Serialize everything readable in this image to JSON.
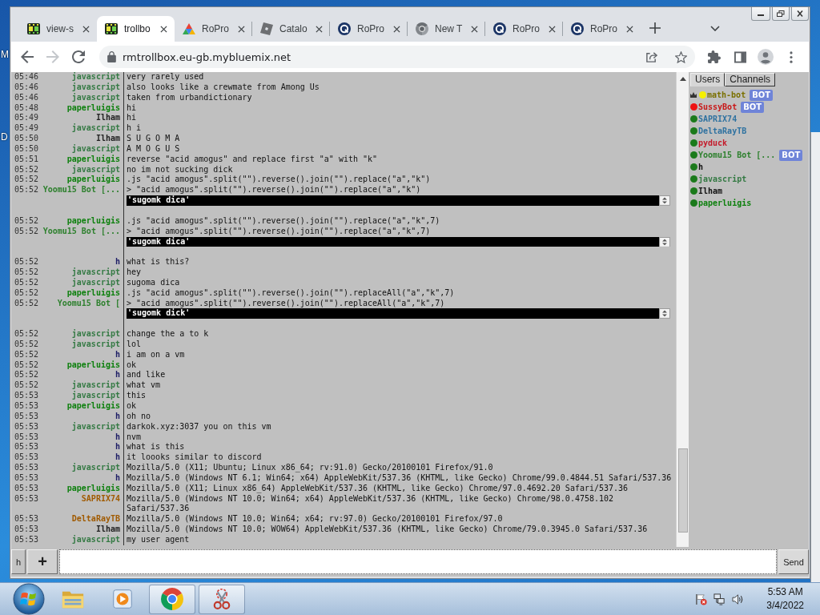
{
  "desktop": {
    "labels": [
      "M",
      "D"
    ]
  },
  "browser": {
    "tabs": [
      {
        "kind": "film",
        "title": "view-s",
        "selected": false
      },
      {
        "kind": "film",
        "title": "trollbo",
        "selected": true
      },
      {
        "kind": "triangle",
        "title": "RoPro",
        "selected": false
      },
      {
        "kind": "tile",
        "title": "Catalo",
        "selected": false
      },
      {
        "kind": "ring",
        "title": "RoPro",
        "selected": false
      },
      {
        "kind": "wheel",
        "title": "New T",
        "selected": false
      },
      {
        "kind": "ring",
        "title": "RoPro",
        "selected": false
      },
      {
        "kind": "ring",
        "title": "RoPro",
        "selected": false
      }
    ],
    "forward_disabled": true,
    "url": "rmtrollbox.eu-gb.mybluemix.net"
  },
  "chat": {
    "messages": [
      {
        "kind": "message",
        "time": "05:46",
        "name": "javascript",
        "color": "#357a44",
        "text": "very rarely used"
      },
      {
        "kind": "message",
        "time": "05:46",
        "name": "javascript",
        "color": "#357a44",
        "text": "also looks like a crewmate from Among Us"
      },
      {
        "kind": "message",
        "time": "05:46",
        "name": "javascript",
        "color": "#357a44",
        "text": "taken from urbandictionary"
      },
      {
        "kind": "message",
        "time": "05:48",
        "name": "paperluigis",
        "color": "#0e800e",
        "text": "hi"
      },
      {
        "kind": "message",
        "time": "05:49",
        "name": "Ilham",
        "color": "#222222",
        "text": "hi"
      },
      {
        "kind": "message",
        "time": "05:49",
        "name": "javascript",
        "color": "#357a44",
        "text": "h i"
      },
      {
        "kind": "message",
        "time": "05:50",
        "name": "Ilham",
        "color": "#222222",
        "text": "S U G O M A"
      },
      {
        "kind": "message",
        "time": "05:50",
        "name": "javascript",
        "color": "#357a44",
        "text": "A M O G U S"
      },
      {
        "kind": "message",
        "time": "05:51",
        "name": "paperluigis",
        "color": "#0e800e",
        "text": "reverse \"acid amogus\" and replace first \"a\" with \"k\""
      },
      {
        "kind": "message",
        "time": "05:52",
        "name": "javascript",
        "color": "#357a44",
        "text": "no im not sucking dick"
      },
      {
        "kind": "message",
        "time": "05:52",
        "name": "paperluigis",
        "color": "#0e800e",
        "text": ".js \"acid amogus\".split(\"\").reverse().join(\"\").replace(\"a\",\"k\")"
      },
      {
        "kind": "message",
        "time": "05:52",
        "name": "Yoomu15 Bot [...",
        "color": "#2e802e",
        "text": "> \"acid amogus\".split(\"\").reverse().join(\"\").replace(\"a\",\"k\")"
      },
      {
        "kind": "result",
        "text": "'sugomk dica'"
      },
      {
        "kind": "message",
        "time": "05:52",
        "name": "paperluigis",
        "color": "#0e800e",
        "text": ".js \"acid amogus\".split(\"\").reverse().join(\"\").replace(\"a\",\"k\",7)"
      },
      {
        "kind": "message",
        "time": "05:52",
        "name": "Yoomu15 Bot [...",
        "color": "#2e802e",
        "text": "> \"acid amogus\".split(\"\").reverse().join(\"\").replace(\"a\",\"k\",7)"
      },
      {
        "kind": "result",
        "text": "'sugomk dica'"
      },
      {
        "kind": "message",
        "time": "05:52",
        "name": "h",
        "color": "#1e1e66",
        "text": "what is this?"
      },
      {
        "kind": "message",
        "time": "05:52",
        "name": "javascript",
        "color": "#357a44",
        "text": "hey"
      },
      {
        "kind": "message",
        "time": "05:52",
        "name": "javascript",
        "color": "#357a44",
        "text": "sugoma dica"
      },
      {
        "kind": "message",
        "time": "05:52",
        "name": "paperluigis",
        "color": "#0e800e",
        "text": ".js \"acid amogus\".split(\"\").reverse().join(\"\").replaceAll(\"a\",\"k\",7)"
      },
      {
        "kind": "message",
        "time": "05:52",
        "name": "Yoomu15 Bot [",
        "color": "#2e802e",
        "text": "> \"acid amogus\".split(\"\").reverse().join(\"\").replaceAll(\"a\",\"k\",7)"
      },
      {
        "kind": "result",
        "text": "'sugomk dick'"
      },
      {
        "kind": "message",
        "time": "05:52",
        "name": "javascript",
        "color": "#357a44",
        "text": "change the a to k"
      },
      {
        "kind": "message",
        "time": "05:52",
        "name": "javascript",
        "color": "#357a44",
        "text": "lol"
      },
      {
        "kind": "message",
        "time": "05:52",
        "name": "h",
        "color": "#1e1e66",
        "text": "i am on a vm"
      },
      {
        "kind": "message",
        "time": "05:52",
        "name": "paperluigis",
        "color": "#0e800e",
        "text": "ok"
      },
      {
        "kind": "message",
        "time": "05:52",
        "name": "h",
        "color": "#1e1e66",
        "text": "and like"
      },
      {
        "kind": "message",
        "time": "05:52",
        "name": "javascript",
        "color": "#357a44",
        "text": "what vm"
      },
      {
        "kind": "message",
        "time": "05:53",
        "name": "javascript",
        "color": "#357a44",
        "text": "this"
      },
      {
        "kind": "message",
        "time": "05:53",
        "name": "paperluigis",
        "color": "#0e800e",
        "text": "ok"
      },
      {
        "kind": "message",
        "time": "05:53",
        "name": "h",
        "color": "#1e1e66",
        "text": "oh no"
      },
      {
        "kind": "message",
        "time": "05:53",
        "name": "javascript",
        "color": "#357a44",
        "text": "darkok.xyz:3037 you on this vm"
      },
      {
        "kind": "message",
        "time": "05:53",
        "name": "h",
        "color": "#1e1e66",
        "text": "nvm"
      },
      {
        "kind": "message",
        "time": "05:53",
        "name": "h",
        "color": "#1e1e66",
        "text": "what is this"
      },
      {
        "kind": "message",
        "time": "05:53",
        "name": "h",
        "color": "#1e1e66",
        "text": "it loooks similar to discord"
      },
      {
        "kind": "message",
        "time": "05:53",
        "name": "javascript",
        "color": "#357a44",
        "text": "Mozilla/5.0 (X11; Ubuntu; Linux x86_64; rv:91.0) Gecko/20100101 Firefox/91.0"
      },
      {
        "kind": "message",
        "time": "05:53",
        "name": "h",
        "color": "#1e1e66",
        "text": "Mozilla/5.0 (Windows NT 6.1; Win64; x64) AppleWebKit/537.36 (KHTML, like Gecko) Chrome/99.0.4844.51 Safari/537.36"
      },
      {
        "kind": "message",
        "time": "05:53",
        "name": "paperluigis",
        "color": "#0e800e",
        "text": "Mozilla/5.0 (X11; Linux x86_64) AppleWebKit/537.36 (KHTML, like Gecko) Chrome/97.0.4692.20 Safari/537.36"
      },
      {
        "kind": "message",
        "time": "05:53",
        "name": "SAPRIX74",
        "color": "#a05a00",
        "text": "Mozilla/5.0 (Windows NT 10.0; Win64; x64) AppleWebKit/537.36 (KHTML, like Gecko) Chrome/98.0.4758.102 Safari/537.36"
      },
      {
        "kind": "message",
        "time": "05:53",
        "name": "DeltaRayTB",
        "color": "#a05a00",
        "text": "Mozilla/5.0 (Windows NT 10.0; Win64; x64; rv:97.0) Gecko/20100101 Firefox/97.0"
      },
      {
        "kind": "message",
        "time": "05:53",
        "name": "Ilham",
        "color": "#222222",
        "text": "Mozilla/5.0 (Windows NT 10.0; WOW64) AppleWebKit/537.36 (KHTML, like Gecko) Chrome/79.0.3945.0 Safari/537.36"
      },
      {
        "kind": "message",
        "time": "05:53",
        "name": "javascript",
        "color": "#357a44",
        "text": "my user agent"
      }
    ]
  },
  "sidebar": {
    "tabs": [
      {
        "label": "Users",
        "selected": true
      },
      {
        "label": "Channels",
        "selected": false
      }
    ],
    "users": [
      {
        "kind": "admin",
        "name": "math-bot",
        "color": "#7a7000",
        "dot": {
          "color": "#f5f000"
        },
        "badge": "BOT"
      },
      {
        "kind": "user",
        "name": "SussyBot",
        "color": "#c81818",
        "dot": {
          "color": "#ee1111"
        },
        "badge": "BOT"
      },
      {
        "kind": "user",
        "name": "SAPRIX74",
        "color": "#2f72a0",
        "dot": {
          "color": "#1b7a1b"
        }
      },
      {
        "kind": "user",
        "name": "DeltaRayTB",
        "color": "#2f72a0",
        "dot": {
          "color": "#1b7a1b"
        }
      },
      {
        "kind": "user",
        "name": "pyduck",
        "color": "#c41a2a",
        "dot": {
          "color": "#1b7a1b"
        }
      },
      {
        "kind": "user",
        "name": "Yoomu15 Bot [...",
        "color": "#2e802e",
        "dot": {
          "color": "#1b7a1b"
        },
        "badge": "BOT"
      },
      {
        "kind": "user",
        "name": "h",
        "color": "#111111",
        "dot": {
          "color": "#1b7a1b"
        }
      },
      {
        "kind": "user",
        "name": "javascript",
        "color": "#357a44",
        "dot": {
          "color": "#1b7a1b"
        }
      },
      {
        "kind": "user",
        "name": "Ilham",
        "color": "#111111",
        "dot": {
          "color": "#1b7a1b"
        }
      },
      {
        "kind": "user",
        "name": "paperluigis",
        "color": "#0e800e",
        "dot": {
          "color": "#1b7a1b"
        }
      }
    ]
  },
  "composer": {
    "nick": "h",
    "add": "+",
    "send": "Send"
  },
  "taskbar": {
    "apps": [
      {
        "kind": "folder",
        "running": false
      },
      {
        "kind": "player",
        "running": false
      },
      {
        "kind": "browser",
        "running": true
      },
      {
        "kind": "scissors",
        "running": true
      }
    ],
    "time": "5:53 AM",
    "date": "3/4/2022"
  }
}
